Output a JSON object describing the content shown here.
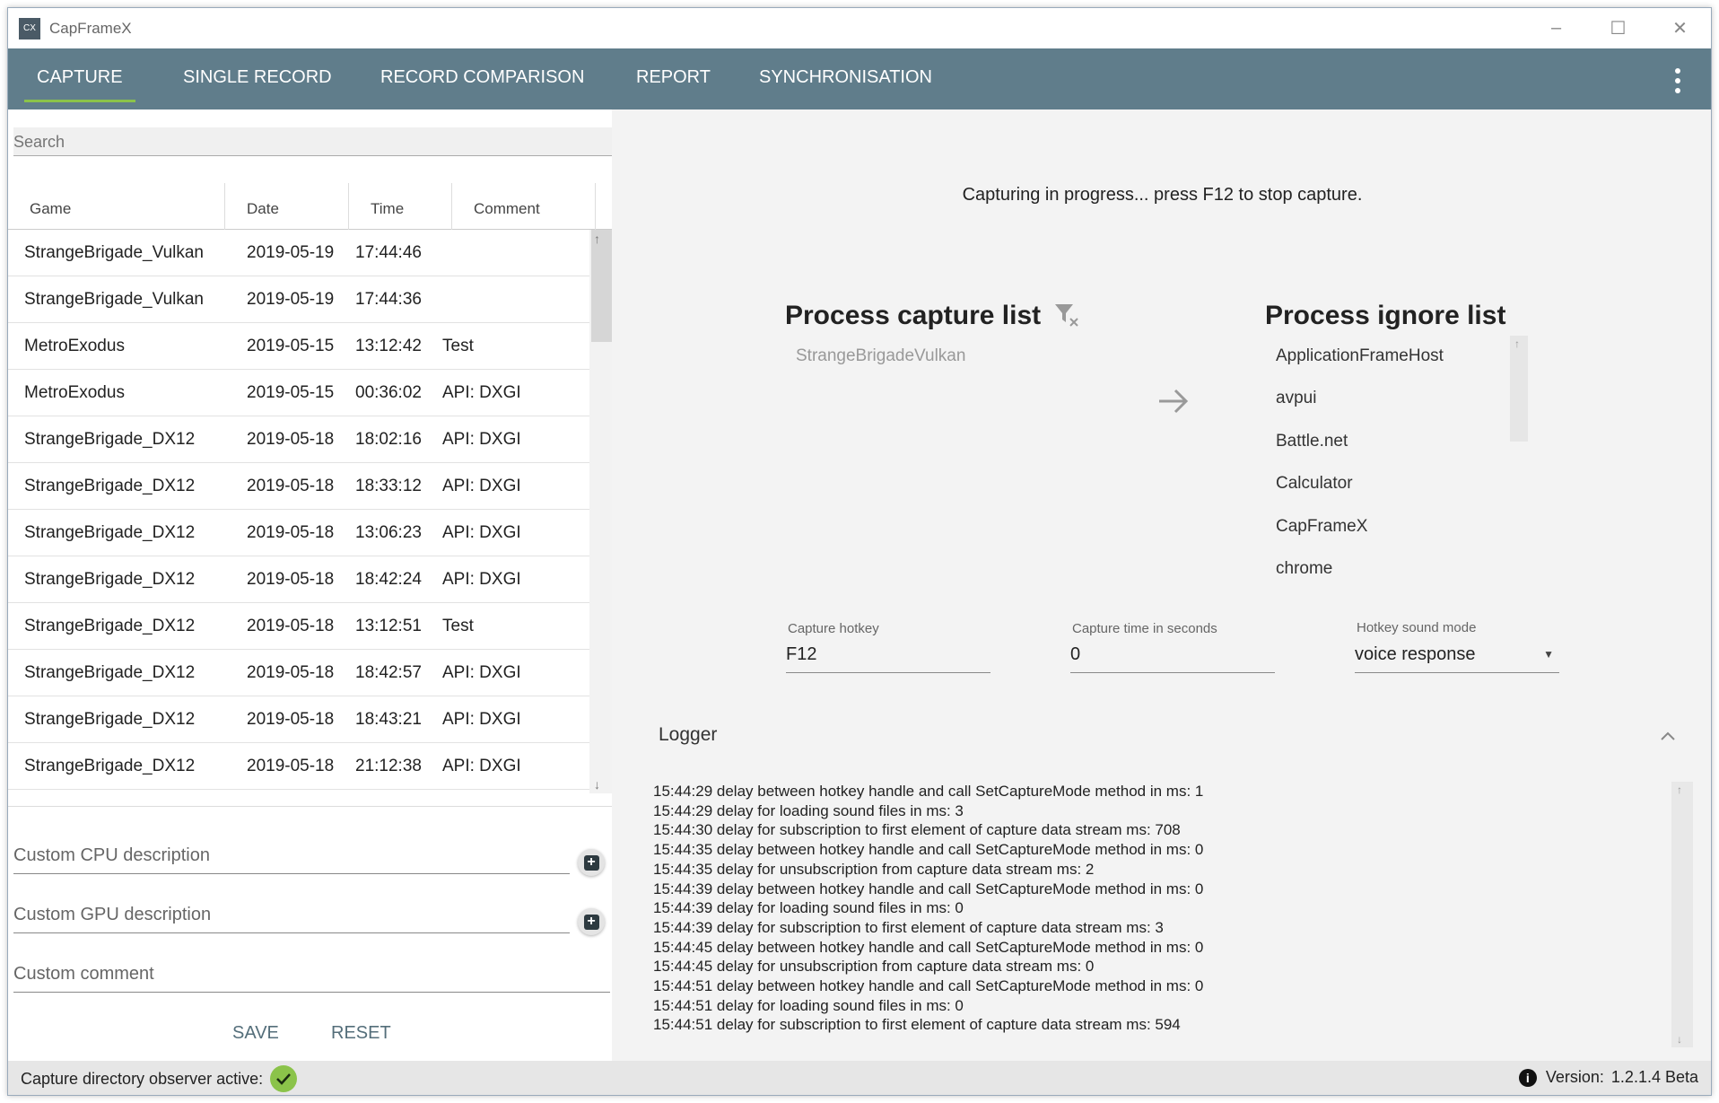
{
  "window": {
    "logo": "CX",
    "title": "CapFrameX",
    "controls": {
      "minimize": "–",
      "maximize": "☐",
      "close": "✕"
    }
  },
  "nav": {
    "tabs": [
      {
        "label": "CAPTURE",
        "active": true
      },
      {
        "label": "SINGLE RECORD",
        "active": false
      },
      {
        "label": "RECORD COMPARISON",
        "active": false
      },
      {
        "label": "REPORT",
        "active": false
      },
      {
        "label": "SYNCHRONISATION",
        "active": false
      }
    ]
  },
  "search": {
    "placeholder": "Search",
    "value": ""
  },
  "table": {
    "headers": [
      "Game",
      "Date",
      "Time",
      "Comment"
    ],
    "rows": [
      [
        "StrangeBrigade_Vulkan",
        "2019-05-19",
        "17:44:46",
        ""
      ],
      [
        "StrangeBrigade_Vulkan",
        "2019-05-19",
        "17:44:36",
        ""
      ],
      [
        "MetroExodus",
        "2019-05-15",
        "13:12:42",
        "Test"
      ],
      [
        "MetroExodus",
        "2019-05-15",
        "00:36:02",
        "API: DXGI"
      ],
      [
        "StrangeBrigade_DX12",
        "2019-05-18",
        "18:02:16",
        "API: DXGI"
      ],
      [
        "StrangeBrigade_DX12",
        "2019-05-18",
        "18:33:12",
        "API: DXGI"
      ],
      [
        "StrangeBrigade_DX12",
        "2019-05-18",
        "13:06:23",
        "API: DXGI"
      ],
      [
        "StrangeBrigade_DX12",
        "2019-05-18",
        "18:42:24",
        "API: DXGI"
      ],
      [
        "StrangeBrigade_DX12",
        "2019-05-18",
        "13:12:51",
        "Test"
      ],
      [
        "StrangeBrigade_DX12",
        "2019-05-18",
        "18:42:57",
        "API: DXGI"
      ],
      [
        "StrangeBrigade_DX12",
        "2019-05-18",
        "18:43:21",
        "API: DXGI"
      ],
      [
        "StrangeBrigade_DX12",
        "2019-05-18",
        "21:12:38",
        "API: DXGI"
      ]
    ]
  },
  "custom": {
    "cpu_placeholder": "Custom CPU description",
    "gpu_placeholder": "Custom GPU description",
    "comment_placeholder": "Custom comment",
    "save_label": "SAVE",
    "reset_label": "RESET"
  },
  "capture": {
    "status_message": "Capturing in progress... press F12 to stop capture.",
    "capture_list_title": "Process capture list",
    "capture_list": [
      "StrangeBrigadeVulkan"
    ],
    "ignore_list_title": "Process ignore list",
    "ignore_list": [
      "ApplicationFrameHost",
      "avpui",
      "Battle.net",
      "Calculator",
      "CapFrameX",
      "chrome"
    ],
    "hotkey_label": "Capture hotkey",
    "hotkey_value": "F12",
    "time_label": "Capture time in seconds",
    "time_value": "0",
    "sound_label": "Hotkey sound mode",
    "sound_value": "voice response"
  },
  "logger": {
    "title": "Logger",
    "lines": [
      "15:44:29 delay between hotkey handle and call SetCaptureMode method in ms: 1",
      "15:44:29 delay for loading sound files in ms: 3",
      "15:44:30 delay for subscription to first element of capture data stream ms: 708",
      "15:44:35 delay between hotkey handle and call SetCaptureMode method in ms: 0",
      "15:44:35 delay for unsubscription from capture data stream ms: 2",
      "15:44:39 delay between hotkey handle and call SetCaptureMode method in ms: 0",
      "15:44:39 delay for loading sound files in ms: 0",
      "15:44:39 delay for subscription to first element of capture data stream ms: 3",
      "15:44:45 delay between hotkey handle and call SetCaptureMode method in ms: 0",
      "15:44:45 delay for unsubscription from capture data stream ms: 0",
      "15:44:51 delay between hotkey handle and call SetCaptureMode method in ms: 0",
      "15:44:51 delay for loading sound files in ms: 0",
      "15:44:51 delay for subscription to first element of capture data stream ms: 594"
    ]
  },
  "status": {
    "observer_text": "Capture directory observer active:",
    "version_label": "Version:",
    "version_value": "1.2.1.4 Beta"
  },
  "colors": {
    "nav_bg": "#607d8b",
    "accent": "#8bc34a",
    "button_text": "#546e7a"
  },
  "icons": [
    "app-logo",
    "minimize-icon",
    "maximize-icon",
    "close-icon",
    "more-vert-icon",
    "filter-remove-icon",
    "arrow-right-icon",
    "chevron-up-icon",
    "plus-icon",
    "check-icon",
    "info-icon",
    "scroll-up-icon",
    "scroll-down-icon"
  ]
}
